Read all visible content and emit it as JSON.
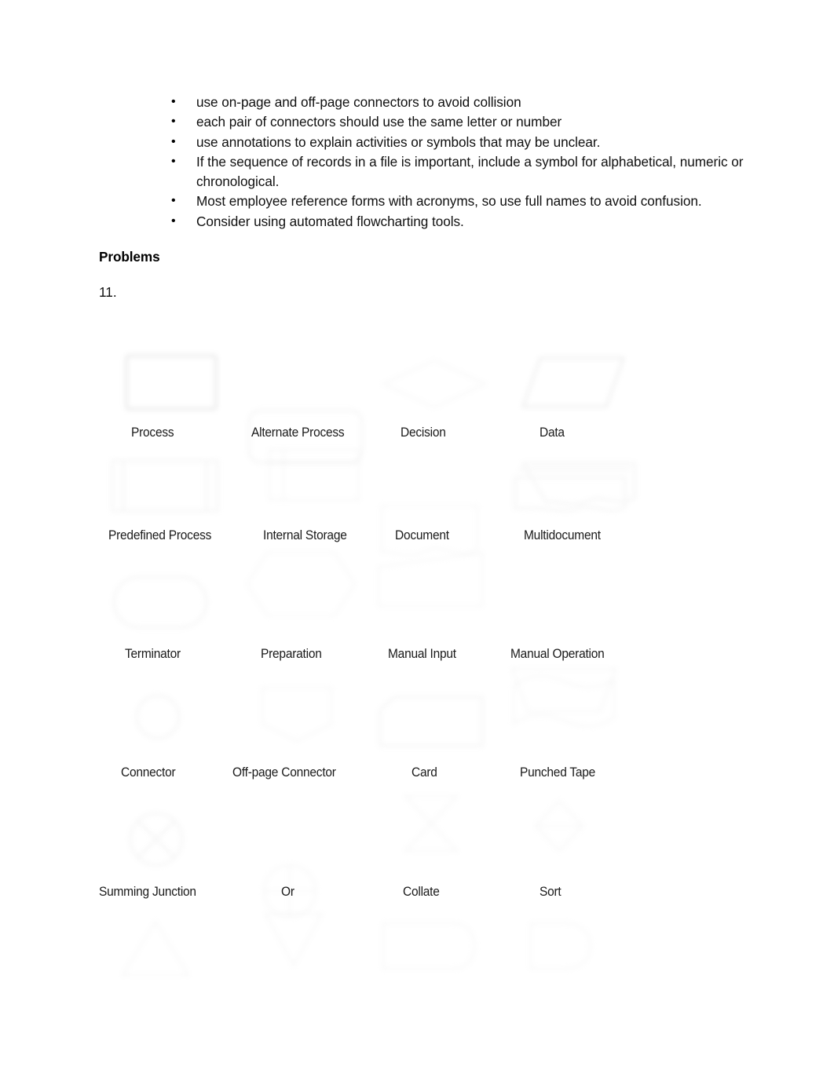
{
  "document": {
    "background_color": "#ffffff",
    "text_color": "#101010"
  },
  "bullets": [
    "use on-page and off-page connectors to avoid collision",
    "each pair of connectors should use the same letter or number",
    "use annotations to explain activities or symbols that may be unclear.",
    "If the sequence of records in a file is important, include a symbol for alphabetical, numeric or chronological.",
    "Most employee reference forms with acronyms, so use full names to avoid confusion.",
    "Consider using automated flowcharting tools."
  ],
  "headings": {
    "problems": "Problems",
    "problem_number": "11."
  },
  "symbol_chart": {
    "caption_color": "#1a1a1a",
    "outline_color": "#b9b9b9",
    "rows": [
      {
        "symbols": [
          {
            "label": "Process",
            "shape": "rectangle"
          },
          {
            "label": "Alternate Process",
            "shape": "rounded-rectangle"
          },
          {
            "label": "Decision",
            "shape": "diamond"
          },
          {
            "label": "Data",
            "shape": "parallelogram"
          }
        ]
      },
      {
        "symbols": [
          {
            "label": "Predefined Process",
            "shape": "predefined-process"
          },
          {
            "label": "Internal Storage",
            "shape": "internal-storage"
          },
          {
            "label": "Document",
            "shape": "document"
          },
          {
            "label": "Multidocument",
            "shape": "multidocument"
          }
        ]
      },
      {
        "symbols": [
          {
            "label": "Terminator",
            "shape": "stadium"
          },
          {
            "label": "Preparation",
            "shape": "hexagon"
          },
          {
            "label": "Manual Input",
            "shape": "manual-input"
          },
          {
            "label": "Manual Operation",
            "shape": "trapezoid"
          }
        ]
      },
      {
        "symbols": [
          {
            "label": "Connector",
            "shape": "circle"
          },
          {
            "label": "Off-page Connector",
            "shape": "off-page-connector"
          },
          {
            "label": "Card",
            "shape": "card"
          },
          {
            "label": "Punched Tape",
            "shape": "punched-tape"
          }
        ]
      },
      {
        "symbols": [
          {
            "label": "Summing Junction",
            "shape": "circle-x"
          },
          {
            "label": "Or",
            "shape": "circle-plus"
          },
          {
            "label": "Collate",
            "shape": "bowtie"
          },
          {
            "label": "Sort",
            "shape": "sort-diamond"
          }
        ]
      },
      {
        "symbols": [
          {
            "label": "",
            "shape": "triangle-up"
          },
          {
            "label": "",
            "shape": "triangle-down"
          },
          {
            "label": "",
            "shape": "delay-left"
          },
          {
            "label": "",
            "shape": "delay-right"
          }
        ]
      }
    ]
  }
}
